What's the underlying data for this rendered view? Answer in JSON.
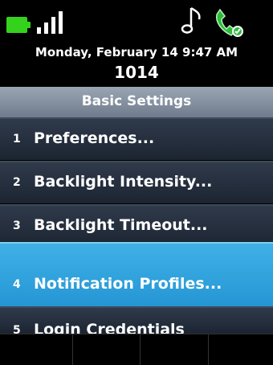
{
  "status_bar": {
    "battery_icon": "battery-full-icon",
    "signal_icon": "signal-bars-icon",
    "music_icon": "music-note-icon",
    "phone_icon": "phone-handset-icon",
    "battery_color": "#35d21d"
  },
  "header": {
    "datetime": "Monday, February 14 9:47 AM",
    "extension": "1014"
  },
  "title": "Basic Settings",
  "menu": [
    {
      "number": "1",
      "label": "Preferences..."
    },
    {
      "number": "2",
      "label": "Backlight Intensity..."
    },
    {
      "number": "3",
      "label": "Backlight Timeout..."
    },
    {
      "number": "4",
      "label": "Notification Profiles...",
      "selected": true
    },
    {
      "number": "5",
      "label": "Login Credentials"
    }
  ],
  "colors": {
    "selected_bg": "#2596d4",
    "item_bg": "#2a3444",
    "title_bg": "#8792a2"
  }
}
